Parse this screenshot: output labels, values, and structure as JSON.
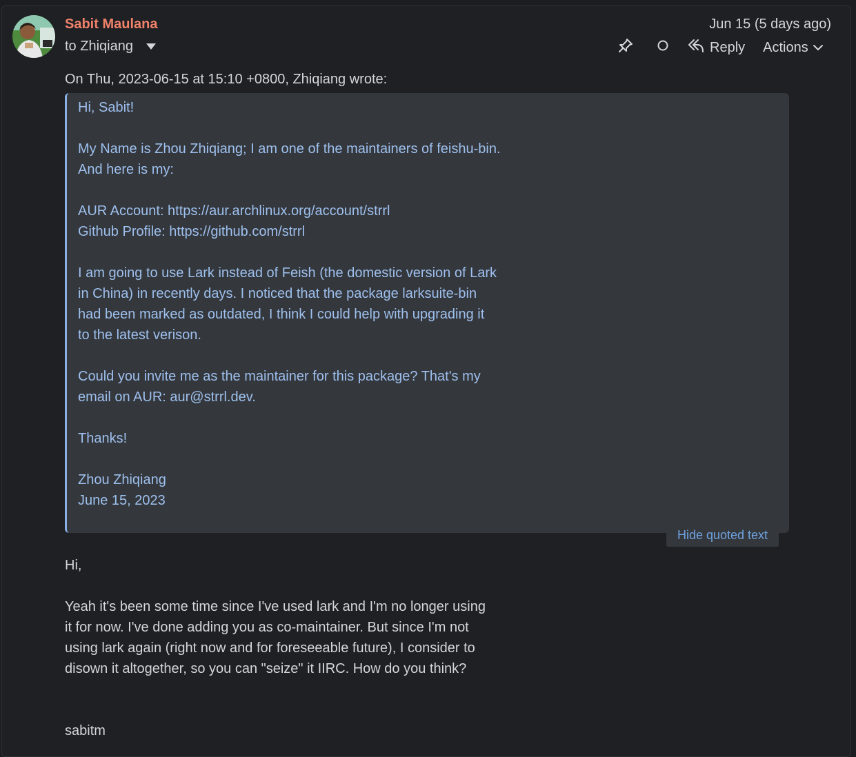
{
  "message": {
    "sender": "Sabit Maulana",
    "recipient": "to Zhiqiang",
    "date": "Jun 15 (5 days ago)",
    "toolbar": {
      "reply_label": "Reply",
      "actions_label": "Actions"
    },
    "quote_intro": "On Thu, 2023-06-15 at 15:10 +0800, Zhiqiang wrote:",
    "quoted_lines": [
      "Hi, Sabit!",
      "",
      "My Name is Zhou Zhiqiang; I am one of the maintainers of feishu-bin.",
      "And here is my:",
      "",
      "AUR Account: https://aur.archlinux.org/account/strrl",
      "Github Profile: https://github.com/strrl",
      "",
      "I am going to use Lark instead of Feish (the domestic version of Lark",
      "in China) in recently days. I noticed that the package larksuite-bin",
      "had been marked as outdated, I think I could help with upgrading it",
      "to the latest verison.",
      "",
      "Could you invite me as the maintainer for this package? That's my",
      "email on AUR: aur@strrl.dev.",
      "",
      "Thanks!",
      "",
      "Zhou Zhiqiang",
      "June 15, 2023"
    ],
    "hide_quoted_label": "Hide quoted text",
    "reply": {
      "greeting": "Hi,",
      "body_lines": [
        "Yeah it's been some time since I've used lark and I'm no longer using",
        "it for now. I've done adding you as co-maintainer. But since I'm not",
        "using lark again (right now and for foreseeable future), I consider to",
        "disown it altogether, so you can \"seize\" it IIRC. How do you think?"
      ],
      "signature": "sabitm"
    }
  },
  "colors": {
    "background": "#1e2024",
    "sender": "#f0826a",
    "text": "#d4d6da",
    "quote_bg": "#34373c",
    "quote_text": "#9ec0ee",
    "quote_border": "#8ab0e8",
    "link": "#6fa3df"
  },
  "icons": [
    "avatar",
    "chevron-down-icon",
    "pin-icon",
    "circle-icon",
    "reply-icon",
    "chevron-down-icon"
  ]
}
